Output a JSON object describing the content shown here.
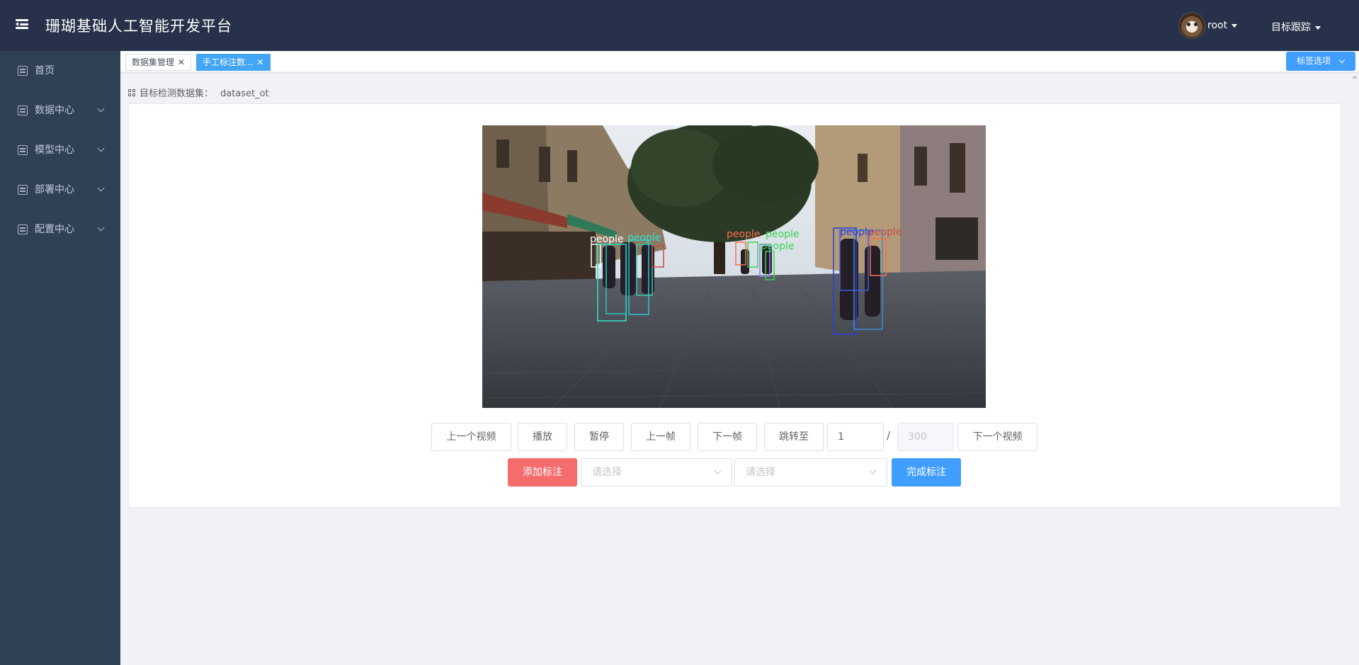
{
  "header": {
    "title": "珊瑚基础人工智能开发平台",
    "user": "root",
    "project_menu": "目标跟踪"
  },
  "sidebar": {
    "items": [
      {
        "label": "首页",
        "has_children": false
      },
      {
        "label": "数据中心",
        "has_children": true
      },
      {
        "label": "模型中心",
        "has_children": true
      },
      {
        "label": "部署中心",
        "has_children": true
      },
      {
        "label": "配置中心",
        "has_children": true
      }
    ]
  },
  "tags": {
    "items": [
      {
        "label": "数据集管理",
        "active": false
      },
      {
        "label": "手工标注数...",
        "active": true
      }
    ],
    "close_glyph": "✕",
    "options_label": "标签选项"
  },
  "dataset": {
    "prefix": "目标检测数据集：",
    "name": "dataset_ot"
  },
  "frame_annotations": [
    {
      "label": "people",
      "color": "#ffffff"
    },
    {
      "label": "people",
      "color": "#2ee6c8"
    },
    {
      "label": "people",
      "color": "#c94b4b"
    },
    {
      "label": "people",
      "color": "#39d353"
    },
    {
      "label": "people",
      "color": "#ff6b4a"
    },
    {
      "label": "people",
      "color": "#8f7cff"
    },
    {
      "label": "people",
      "color": "#2b3fd6"
    }
  ],
  "controls": {
    "prev_video": "上一个视频",
    "play": "播放",
    "pause": "暂停",
    "prev_frame": "上一帧",
    "next_frame": "下一帧",
    "jump_to": "跳转至",
    "frame_value": "1",
    "separator": "/",
    "total_frames": "300",
    "next_video": "下一个视频"
  },
  "annotate": {
    "add_label": "添加标注",
    "select1_placeholder": "请选择",
    "select2_placeholder": "请选择",
    "done_label": "完成标注"
  },
  "colors": {
    "header_bg": "#27324a",
    "sidebar_bg": "#304156",
    "primary": "#409eff",
    "danger": "#f56c6c"
  }
}
